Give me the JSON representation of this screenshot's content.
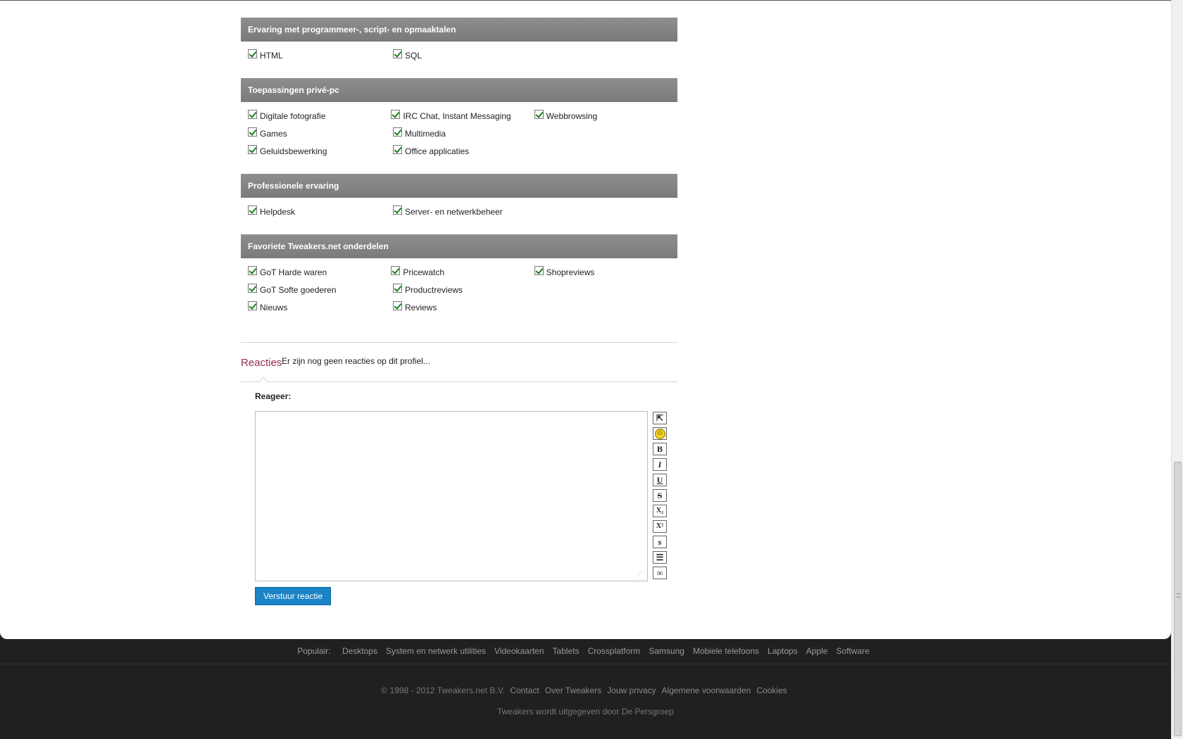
{
  "sections": [
    {
      "title": "Ervaring met programmeer-, script- en opmaaktalen",
      "rows": [
        [
          "HTML",
          "SQL"
        ]
      ]
    },
    {
      "title": "Toepassingen privé-pc",
      "rows": [
        [
          "Digitale fotografie",
          "IRC Chat, Instant Messaging",
          "Webbrowsing"
        ],
        [
          "Games",
          "Multimedia"
        ],
        [
          "Geluidsbewerking",
          "Office applicaties"
        ]
      ]
    },
    {
      "title": "Professionele ervaring",
      "rows": [
        [
          "Helpdesk",
          "Server- en netwerkbeheer"
        ]
      ]
    },
    {
      "title": "Favoriete Tweakers.net onderdelen",
      "rows": [
        [
          "GoT Harde waren",
          "Pricewatch",
          "Shopreviews"
        ],
        [
          "GoT Softe goederen",
          "Productreviews"
        ],
        [
          "Nieuws",
          "Reviews"
        ]
      ]
    }
  ],
  "reactions": {
    "title": "Reacties",
    "empty_text": "Er zijn nog geen reacties op dit profiel...",
    "reply_label": "Reageer:",
    "submit_label": "Verstuur reactie",
    "toolbar": [
      {
        "name": "popout-icon",
        "glyph": "⇱"
      },
      {
        "name": "smiley-icon",
        "glyph": "☺"
      },
      {
        "name": "bold-icon",
        "glyph": "B"
      },
      {
        "name": "italic-icon",
        "glyph": "I"
      },
      {
        "name": "underline-icon",
        "glyph": "U"
      },
      {
        "name": "strikethrough-icon",
        "glyph": "S"
      },
      {
        "name": "subscript-icon",
        "glyph": "X₂"
      },
      {
        "name": "superscript-icon",
        "glyph": "X²"
      },
      {
        "name": "small-text-icon",
        "glyph": "s"
      },
      {
        "name": "list-icon",
        "glyph": "☰"
      },
      {
        "name": "link-icon",
        "glyph": "∞"
      }
    ]
  },
  "footer": {
    "popular_label": "Populair:",
    "popular": [
      "Desktops",
      "System en netwerk utilities",
      "Videokaarten",
      "Tablets",
      "Crossplatform",
      "Samsung",
      "Mobiele telefoons",
      "Laptops",
      "Apple",
      "Software"
    ],
    "copyright": "© 1998 - 2012 Tweakers.net B.V.",
    "links": [
      "Contact",
      "Over Tweakers",
      "Jouw privacy",
      "Algemene voorwaarden",
      "Cookies"
    ],
    "publisher": "Tweakers wordt uitgegeven door De Persgroep"
  }
}
